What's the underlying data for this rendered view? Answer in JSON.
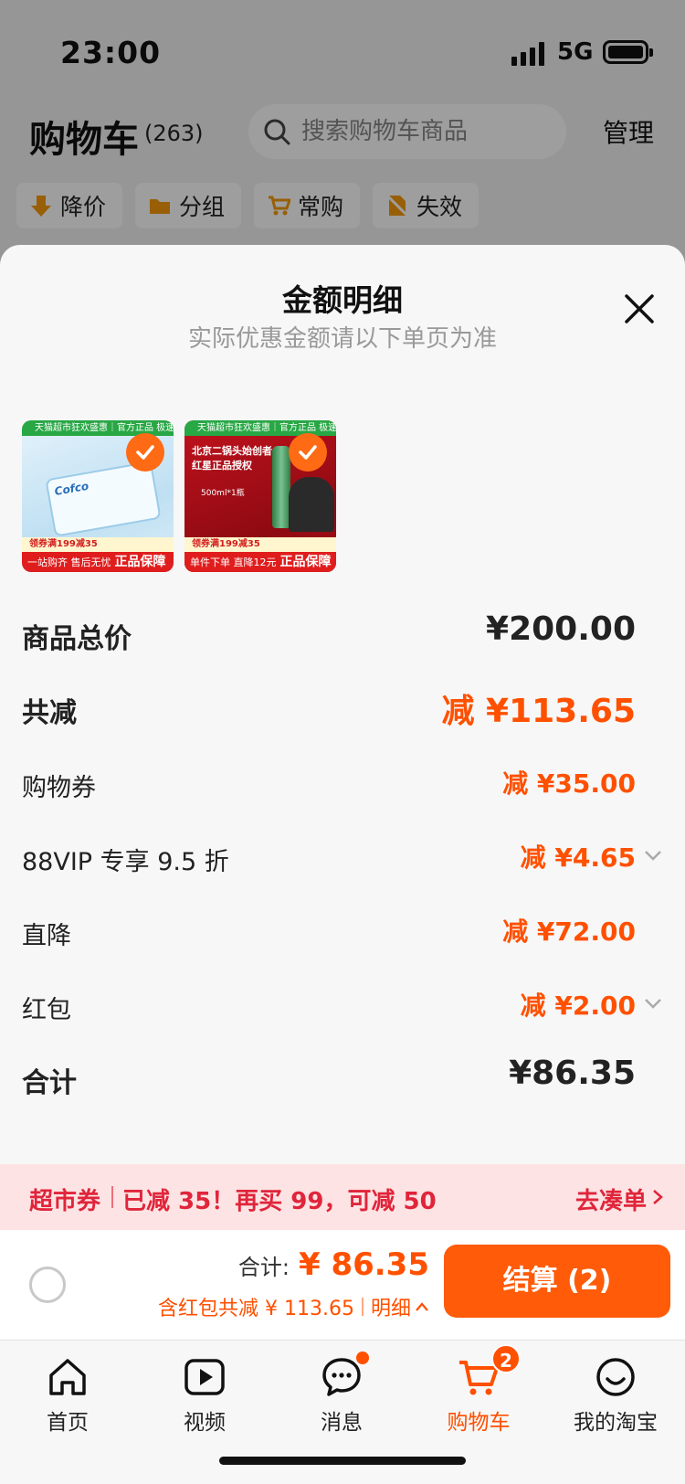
{
  "status_bar": {
    "time": "23:00",
    "network": "5G"
  },
  "cart_header": {
    "title": "购物车",
    "count": "(263)",
    "search_placeholder": "搜索购物车商品",
    "manage": "管理"
  },
  "filters": [
    {
      "label": "降价",
      "icon": "price-down-icon"
    },
    {
      "label": "分组",
      "icon": "folder-icon"
    },
    {
      "label": "常购",
      "icon": "cart-icon"
    },
    {
      "label": "失效",
      "icon": "expired-icon"
    }
  ],
  "sheet": {
    "title": "金额明细",
    "subtitle": "实际优惠金额请以下单页为准",
    "products": [
      {
        "banner": "天猫超市狂欢盛惠｜官方正品 极速送达",
        "brand": "Cofco",
        "coupon": "领券满199减35",
        "bottom_left": "一站购齐 售后无忧",
        "bottom_right": "正品保障",
        "selected": true
      },
      {
        "banner": "天猫超市狂欢盛惠｜官方正品 极速送达",
        "headline_1": "北京二锅头始创者",
        "headline_2": "红星正品授权",
        "spec": "500ml*1瓶",
        "coupon": "领券满199减35",
        "bottom_left": "单件下单 直降12元",
        "bottom_right": "正品保障",
        "selected": true
      }
    ],
    "rows": {
      "goods_total": {
        "label": "商品总价",
        "value": "¥200.00"
      },
      "total_discount": {
        "label": "共减",
        "value": "减 ¥113.65"
      },
      "coupon": {
        "label": "购物券",
        "value": "减 ¥35.00"
      },
      "vip": {
        "label": "88VIP 专享 9.5 折",
        "value": "减 ¥4.65"
      },
      "direct": {
        "label": "直降",
        "value": "减 ¥72.00"
      },
      "red_packet": {
        "label": "红包",
        "value": "减 ¥2.00"
      },
      "grand_total": {
        "label": "合计",
        "value": "¥86.35"
      }
    }
  },
  "promo": {
    "tag": "超市券",
    "text": "已减 35！再买 99，可减 50",
    "link": "去凑单"
  },
  "checkout": {
    "total_label": "合计:",
    "total_amount": "¥ 86.35",
    "discount_text": "含红包共减 ¥ 113.65",
    "detail_link": "明细",
    "button": "结算 (2)"
  },
  "tabbar": [
    {
      "label": "首页",
      "icon": "home-icon"
    },
    {
      "label": "视频",
      "icon": "video-icon"
    },
    {
      "label": "消息",
      "icon": "message-icon",
      "dot": true
    },
    {
      "label": "购物车",
      "icon": "cart-icon",
      "badge": "2",
      "active": true
    },
    {
      "label": "我的淘宝",
      "icon": "profile-icon"
    }
  ],
  "colors": {
    "accent": "#ff5000",
    "promo_red": "#e0253b",
    "checkout_button": "#ff5b08"
  }
}
